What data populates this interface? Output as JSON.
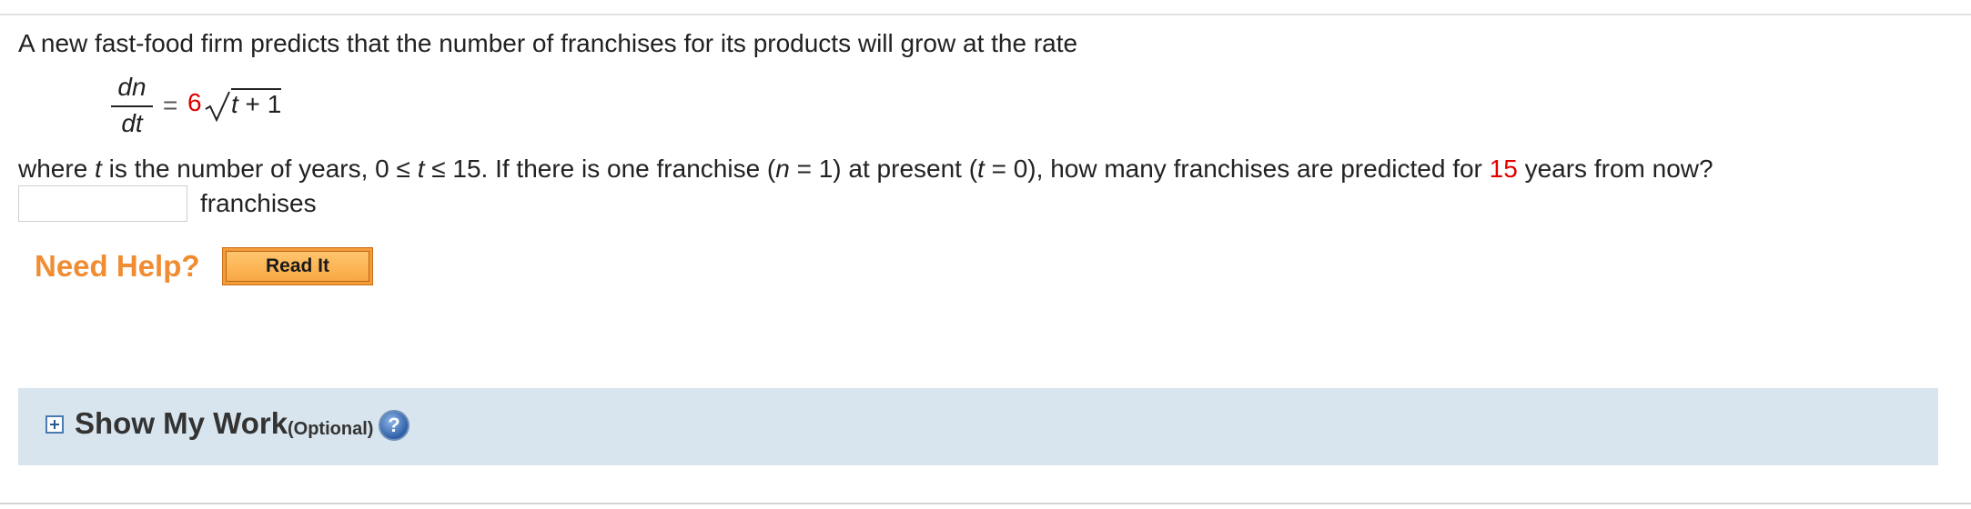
{
  "question": {
    "intro": "A new fast-food firm predicts that the number of franchises for its products will grow at the rate",
    "equation": {
      "numerator": "dn",
      "denominator": "dt",
      "equals": "=",
      "coefficient": "6",
      "radicand_var": "t",
      "radicand_rest": " + 1"
    },
    "where": {
      "part1": "where ",
      "t1": "t",
      "part2": " is the number of years, 0 ≤ ",
      "t2": "t",
      "part3": " ≤ 15. If there is one franchise (",
      "n": "n",
      "part4": " = 1) at present (",
      "t3": "t",
      "part5": " = 0), how many franchises are predicted for ",
      "years_value": "15",
      "part6": " years from now?"
    },
    "answer": {
      "value": "",
      "placeholder": "",
      "unit": "franchises"
    }
  },
  "help": {
    "label": "Need Help?",
    "read_it_label": "Read It"
  },
  "show_my_work": {
    "title": "Show My Work",
    "optional": "(Optional)",
    "help_glyph": "?"
  },
  "colors": {
    "accent_red": "#e00000",
    "help_orange": "#f08c32",
    "panel_blue": "#d8e5ee"
  }
}
